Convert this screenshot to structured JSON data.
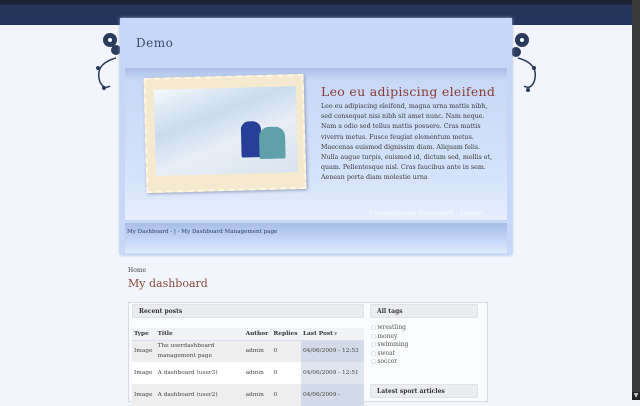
{
  "site": {
    "name": "Demo"
  },
  "banner": {
    "heading": "Leo eu adipiscing eleifend",
    "body": "Leo eu adipiscing eleifend, magna urna mattis nibh, sed consequat nisi nibh sit amet nunc. Nam neque. Nam a odio sed tellus mattis posuere. Cras mattis viverra metus. Fusce feugiat elementum metus. Maecenas euismod dignissim diam. Aliquam felis. Nulla augue turpis, euismod id, dictum sed, mollis et, quam. Pellentesque nisl. Cras faucibus ante in sem. Aenean porta diam molestie urna",
    "credit": "Userdashboard screenshots - Lugand"
  },
  "nav": {
    "links": "My Dashboard - | - My Dashboard Management page"
  },
  "breadcrumb": "Home",
  "page_title": "My dashboard",
  "recent_posts": {
    "title": "Recent posts",
    "columns": [
      "Type",
      "Title",
      "Author",
      "Replies",
      "Last Post"
    ],
    "rows": [
      {
        "type": "Image",
        "title": "The userdashboard management page",
        "author": "admin",
        "replies": "0",
        "last": "04/06/2009 - 12:53"
      },
      {
        "type": "Image",
        "title": "A dashboard (user3)",
        "author": "admin",
        "replies": "0",
        "last": "04/06/2009 - 12:51"
      },
      {
        "type": "Image",
        "title": "A dashboard (user2)",
        "author": "admin",
        "replies": "0",
        "last": "04/06/2009 -"
      }
    ]
  },
  "tags": {
    "title": "All tags",
    "items": [
      "wrestling",
      "money",
      "swimming",
      "sweat",
      "soccer"
    ]
  },
  "sport": {
    "title": "Latest sport articles"
  }
}
